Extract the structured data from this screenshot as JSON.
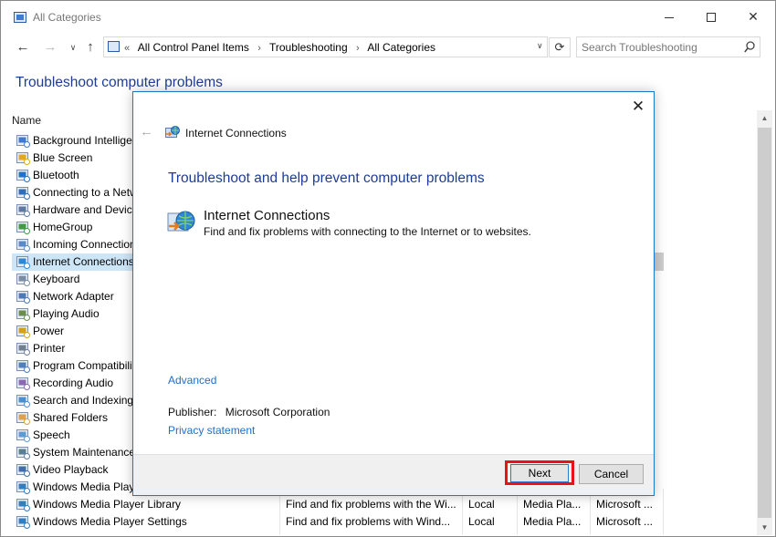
{
  "window": {
    "title": "All Categories",
    "minimize_icon": "minimize-icon",
    "maximize_icon": "maximize-icon",
    "close_glyph": "✕"
  },
  "nav": {
    "back_glyph": "←",
    "forward_glyph": "→",
    "recent_glyph": "∨",
    "up_glyph": "↑",
    "refresh_glyph": "⟳"
  },
  "address": {
    "prefix": "«",
    "crumbs": [
      "All Control Panel Items",
      "Troubleshooting",
      "All Categories"
    ],
    "separator": "›",
    "dropdown_glyph": "∨"
  },
  "search": {
    "placeholder": "Search Troubleshooting"
  },
  "page": {
    "title": "Troubleshoot computer problems",
    "name_column": "Name"
  },
  "list": {
    "items": [
      {
        "name": "Background Intelligent Transfer Service",
        "icon": "background-transfer-icon"
      },
      {
        "name": "Blue Screen",
        "icon": "windows-flag-icon"
      },
      {
        "name": "Bluetooth",
        "icon": "bluetooth-icon"
      },
      {
        "name": "Connecting to a Network",
        "icon": "network-icon"
      },
      {
        "name": "Hardware and Devices",
        "icon": "hardware-icon"
      },
      {
        "name": "HomeGroup",
        "icon": "homegroup-icon"
      },
      {
        "name": "Incoming Connections",
        "icon": "incoming-connections-icon"
      },
      {
        "name": "Internet Connections",
        "icon": "internet-connections-icon",
        "selected": true
      },
      {
        "name": "Keyboard",
        "icon": "keyboard-icon"
      },
      {
        "name": "Network Adapter",
        "icon": "network-adapter-icon"
      },
      {
        "name": "Playing Audio",
        "icon": "audio-icon"
      },
      {
        "name": "Power",
        "icon": "power-icon"
      },
      {
        "name": "Printer",
        "icon": "printer-icon"
      },
      {
        "name": "Program Compatibility Troubleshooter",
        "icon": "program-compatibility-icon"
      },
      {
        "name": "Recording Audio",
        "icon": "recording-audio-icon"
      },
      {
        "name": "Search and Indexing",
        "icon": "search-indexing-icon"
      },
      {
        "name": "Shared Folders",
        "icon": "shared-folders-icon"
      },
      {
        "name": "Speech",
        "icon": "speech-icon"
      },
      {
        "name": "System Maintenance",
        "icon": "system-maintenance-icon"
      },
      {
        "name": "Video Playback",
        "icon": "video-playback-icon"
      },
      {
        "name": "Windows Media Player DVD",
        "icon": "media-player-icon"
      },
      {
        "name": "Windows Media Player Library",
        "icon": "media-player-icon",
        "description": "Find and fix problems with the Wi...",
        "location": "Local",
        "category": "Media Pla...",
        "publisher": "Microsoft ..."
      },
      {
        "name": "Windows Media Player Settings",
        "icon": "media-player-icon",
        "description": "Find and fix problems with Wind...",
        "location": "Local",
        "category": "Media Pla...",
        "publisher": "Microsoft ..."
      }
    ]
  },
  "scrollbar": {
    "up_glyph": "▲",
    "down_glyph": "▼"
  },
  "dialog": {
    "close_glyph": "✕",
    "back_glyph": "←",
    "title": "Internet Connections",
    "heading": "Troubleshoot and help prevent computer problems",
    "item_title": "Internet Connections",
    "item_description": "Find and fix problems with connecting to the Internet or to websites.",
    "advanced_link": "Advanced",
    "publisher_label": "Publisher:",
    "publisher_value": "Microsoft Corporation",
    "privacy_link": "Privacy statement",
    "next_button": "Next",
    "cancel_button": "Cancel",
    "highlight_color": "#e8121c"
  }
}
